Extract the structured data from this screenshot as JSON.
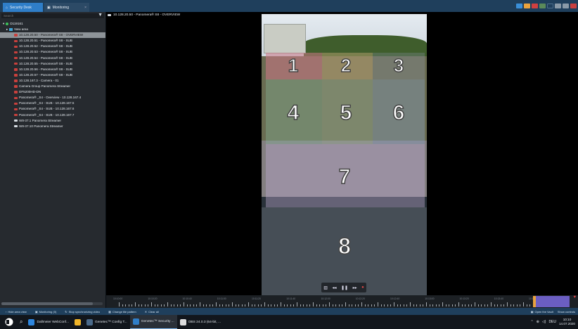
{
  "tabs": [
    {
      "label": "Security Desk",
      "icon": "home-icon"
    },
    {
      "label": "Monitoring",
      "icon": "monitor-icon",
      "close": "×"
    }
  ],
  "window_tray": {
    "dim_text": "10:10"
  },
  "sidebar": {
    "search_placeholder": "Search",
    "filter_icon": "▼",
    "root": "D119161",
    "area": "New area",
    "items": [
      {
        "label": "10.128.20.50 - Panomera® S8 - OVERVIEW",
        "selected": true
      },
      {
        "label": "10.128.20.51 - Panomera® S8 - SUB"
      },
      {
        "label": "10.128.20.52 - Panomera® S8 - SUB"
      },
      {
        "label": "10.128.20.53 - Panomera® S8 - SUB"
      },
      {
        "label": "10.128.20.54 - Panomera® S8 - SUB"
      },
      {
        "label": "10.128.20.55 - Panomera® S8 - SUB"
      },
      {
        "label": "10.128.20.56 - Panomera® S8 - SUB"
      },
      {
        "label": "10.128.20.57 - Panomera® S8 - SUB"
      },
      {
        "label": "10.128.167.3 - Camera - 01"
      },
      {
        "label": "Camera Group Panomera Streamer"
      },
      {
        "label": "DF5200HD-DN"
      },
      {
        "label": "Panomera® _S4 - Overview - 10.128.167.4"
      },
      {
        "label": "Panomera® _S4 - SUB - 10.128.167.5"
      },
      {
        "label": "Panomera® _S4 - SUB - 10.128.167.6"
      },
      {
        "label": "Panomera® _S4 - SUB - 10.128.167.7"
      },
      {
        "label": "W8-37.1 Panomera Streamer",
        "white": true
      },
      {
        "label": "W8-37.10 Panomera Streamer",
        "white": true
      }
    ]
  },
  "tile": {
    "title": "10.128.20.50 - Panomera® S8 - OVERVIEW",
    "zones": [
      "1",
      "2",
      "3",
      "4",
      "5",
      "6",
      "7",
      "8"
    ]
  },
  "video_controls": [
    "▥",
    "◂◂",
    "❚❚",
    "▸▸",
    "●"
  ],
  "timeline": {
    "labels": [
      "10:10:00",
      "10:10:20",
      "10:10:40",
      "10:11:00",
      "10:11:20",
      "10:11:40",
      "10:12:00",
      "10:12:20",
      "10:12:40",
      "10:13:00",
      "10:13:20",
      "10:13:40",
      "10:14:00"
    ]
  },
  "bottombar": {
    "items": [
      "Hide area view",
      "Monitoring (0)",
      "Stop synchronizing video",
      "Change tile pattern",
      "Clear all"
    ],
    "right": [
      "Open the Vault",
      "Show controls"
    ]
  },
  "taskbar": {
    "apps": [
      {
        "label": "Dallmeier WebConf...",
        "color": "#2e86de"
      },
      {
        "label": "",
        "color": "#f0b429"
      },
      {
        "label": "Genetec™ Config T...",
        "color": "#4b6a8a"
      },
      {
        "label": "Genetec™ Security ...",
        "color": "#2f7ec8",
        "active": true
      },
      {
        "label": "OBS 24.0.3 (64-bit, ...",
        "color": "#ddd"
      }
    ],
    "lang": "DEU",
    "time": "10:10",
    "date": "14.07.2020"
  },
  "colors": {
    "topbar": "#1f3f5c",
    "accent": "#2f7ec8",
    "sidebar": "#262a2f",
    "selected": "#8e9499"
  }
}
